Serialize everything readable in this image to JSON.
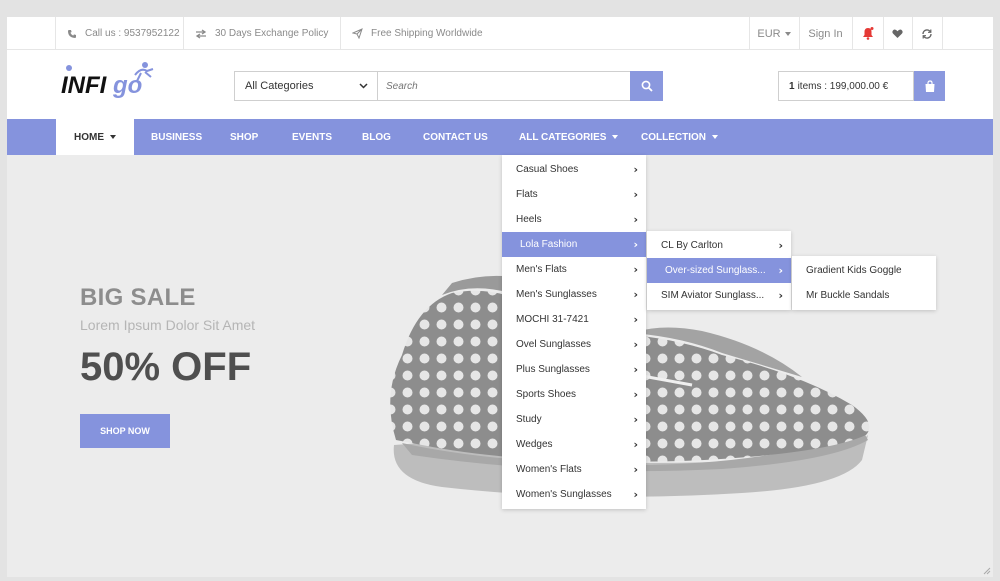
{
  "topbar": {
    "phone": "Call us : 9537952122",
    "exchange": "30 Days Exchange Policy",
    "shipping": "Free Shipping Worldwide",
    "currency": "EUR",
    "signin": "Sign In"
  },
  "logo": {
    "text": "INFIGO"
  },
  "search": {
    "category": "All Categories",
    "placeholder": "Search"
  },
  "cart": {
    "count": "1",
    "summary": "items : 199,000.00 €"
  },
  "nav": {
    "items": [
      {
        "label": "HOME"
      },
      {
        "label": "BUSINESS"
      },
      {
        "label": "SHOP"
      },
      {
        "label": "EVENTS"
      },
      {
        "label": "BLOG"
      },
      {
        "label": "CONTACT US"
      },
      {
        "label": "ALL CATEGORIES"
      },
      {
        "label": "COLLECTION"
      }
    ]
  },
  "hero": {
    "title": "BIG SALE",
    "subtitle": "Lorem Ipsum Dolor Sit Amet",
    "offer": "50% OFF",
    "cta": "SHOP NOW"
  },
  "menu1": [
    {
      "label": "Casual Shoes"
    },
    {
      "label": "Flats"
    },
    {
      "label": "Heels"
    },
    {
      "label": "Lola Fashion"
    },
    {
      "label": "Men's Flats"
    },
    {
      "label": "Men's Sunglasses"
    },
    {
      "label": "MOCHI 31-7421"
    },
    {
      "label": "Ovel Sunglasses"
    },
    {
      "label": "Plus Sunglasses"
    },
    {
      "label": "Sports Shoes"
    },
    {
      "label": "Study"
    },
    {
      "label": "Wedges"
    },
    {
      "label": "Women's Flats"
    },
    {
      "label": "Women's Sunglasses"
    }
  ],
  "menu2": [
    {
      "label": "CL By Carlton"
    },
    {
      "label": "Over-sized Sunglass..."
    },
    {
      "label": "SIM Aviator Sunglass..."
    }
  ],
  "menu3": [
    {
      "label": "Gradient Kids Goggle"
    },
    {
      "label": "Mr Buckle Sandals"
    }
  ],
  "colors": {
    "accent": "#8593dd",
    "notify": "#e53935"
  }
}
